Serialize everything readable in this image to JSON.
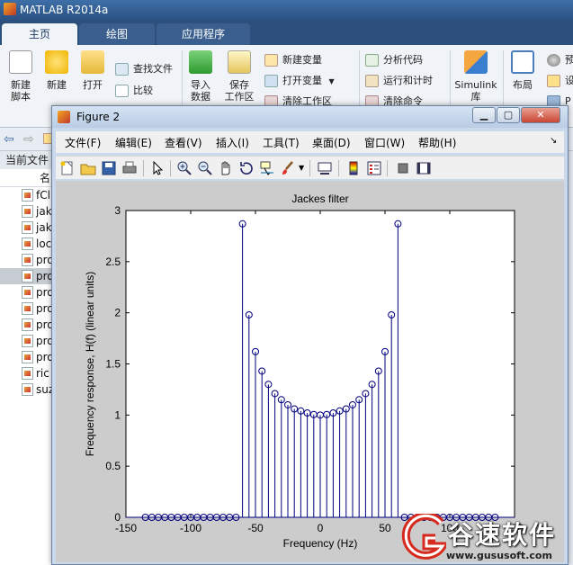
{
  "main_window": {
    "title": "MATLAB R2014a",
    "tabs": [
      {
        "label": "主页",
        "active": true
      },
      {
        "label": "绘图",
        "active": false
      },
      {
        "label": "应用程序",
        "active": false
      }
    ],
    "ribbon": {
      "new_script": "新建\n脚本",
      "new": "新建",
      "open": "打开",
      "find_files": "查找文件",
      "compare": "比较",
      "import_data": "导入\n数据",
      "save_workspace": "保存\n工作区",
      "new_variable": "新建变量",
      "open_variable": "打开变量",
      "clear_workspace": "清除工作区",
      "analyze_code": "分析代码",
      "run_and_time": "运行和计时",
      "clear_commands": "清除命令",
      "simulink": "Simulink\n库",
      "layout": "布局",
      "preferences": "预",
      "set_path": "设",
      "parallel": "P"
    },
    "current_folder": {
      "title": "当前文件",
      "name_column": "名",
      "files": [
        {
          "name": "fCl",
          "selected": false
        },
        {
          "name": "jak",
          "selected": false
        },
        {
          "name": "jak",
          "selected": false
        },
        {
          "name": "loc",
          "selected": false
        },
        {
          "name": "pro",
          "selected": false
        },
        {
          "name": "pro",
          "selected": true
        },
        {
          "name": "pro",
          "selected": false
        },
        {
          "name": "pro",
          "selected": false
        },
        {
          "name": "pro",
          "selected": false
        },
        {
          "name": "pro",
          "selected": false
        },
        {
          "name": "pro",
          "selected": false
        },
        {
          "name": "ric",
          "selected": false
        },
        {
          "name": "suz",
          "selected": false
        }
      ]
    }
  },
  "figure_window": {
    "title": "Figure 2",
    "menus": [
      "文件(F)",
      "编辑(E)",
      "查看(V)",
      "插入(I)",
      "工具(T)",
      "桌面(D)",
      "窗口(W)",
      "帮助(H)"
    ],
    "toolbar_icons": [
      "new-figure-icon",
      "open-file-icon",
      "save-icon",
      "print-icon",
      "pointer-icon",
      "zoom-in-icon",
      "zoom-out-icon",
      "pan-icon",
      "rotate-3d-icon",
      "data-cursor-icon",
      "brush-icon",
      "link-plot-icon",
      "colorbar-icon",
      "legend-icon",
      "hide-plot-tools-icon",
      "show-plot-tools-icon"
    ]
  },
  "chart_data": {
    "type": "stem",
    "title": "Jackes filter",
    "xlabel": "Frequency (Hz)",
    "ylabel": "Frequency response, H(f) (linear units)",
    "xlim": [
      -150,
      150
    ],
    "ylim": [
      0,
      3
    ],
    "xticks": [
      "-150",
      "-100",
      "-50",
      "0",
      "50",
      "100",
      "150"
    ],
    "yticks": [
      "0",
      "0.5",
      "1",
      "1.5",
      "2",
      "2.5",
      "3"
    ],
    "marker": "circle",
    "color": "#00007f",
    "grid": false,
    "x": [
      -135,
      -130,
      -125,
      -120,
      -115,
      -110,
      -105,
      -100,
      -95,
      -90,
      -85,
      -80,
      -75,
      -70,
      -65,
      -60,
      -55,
      -50,
      -45,
      -40,
      -35,
      -30,
      -25,
      -20,
      -15,
      -10,
      -5,
      0,
      5,
      10,
      15,
      20,
      25,
      30,
      35,
      40,
      45,
      50,
      55,
      60,
      65,
      70,
      75,
      80,
      85,
      90,
      95,
      100,
      105,
      110,
      115,
      120,
      125,
      130,
      135
    ],
    "y": [
      0,
      0,
      0,
      0,
      0,
      0,
      0,
      0,
      0,
      0,
      0,
      0,
      0,
      0,
      0,
      2.87,
      1.98,
      1.62,
      1.43,
      1.3,
      1.21,
      1.15,
      1.1,
      1.06,
      1.04,
      1.02,
      1.005,
      1.0,
      1.005,
      1.02,
      1.04,
      1.06,
      1.1,
      1.15,
      1.21,
      1.3,
      1.43,
      1.62,
      1.98,
      2.87,
      0,
      0,
      0,
      0,
      0,
      0,
      0,
      0,
      0,
      0,
      0,
      0,
      0,
      0,
      0
    ]
  },
  "watermark": {
    "text": "谷速软件",
    "url": "www.gususoft.com",
    "color": "#d62a1e"
  }
}
